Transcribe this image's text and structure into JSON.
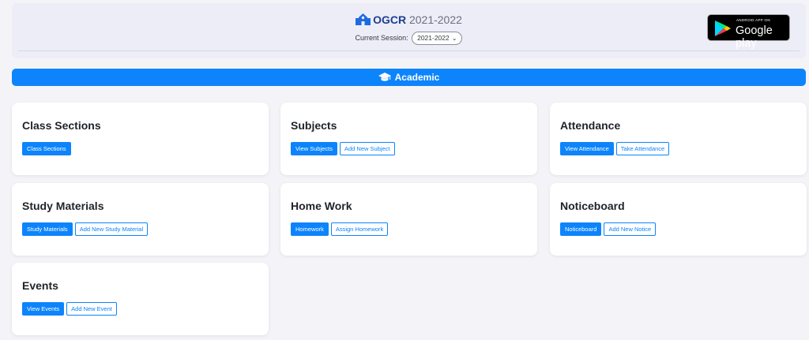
{
  "header": {
    "app_name": "OGCR",
    "app_year": "2021-2022",
    "session_label": "Current Session:",
    "session_value": "2021-2022",
    "store_badge_top": "ANDROID APP ON",
    "store_badge_name": "Google play"
  },
  "section": {
    "title": "Academic"
  },
  "cards": [
    {
      "title": "Class Sections",
      "primary": "Class Sections",
      "secondary": ""
    },
    {
      "title": "Subjects",
      "primary": "View Subjects",
      "secondary": "Add New Subject"
    },
    {
      "title": "Attendance",
      "primary": "View Attendance",
      "secondary": "Take Attendance"
    },
    {
      "title": "Study Materials",
      "primary": "Study Materials",
      "secondary": "Add New Study Material"
    },
    {
      "title": "Home Work",
      "primary": "Homework",
      "secondary": "Assign Homework"
    },
    {
      "title": "Noticeboard",
      "primary": "Noticeboard",
      "secondary": "Add New Notice"
    },
    {
      "title": "Events",
      "primary": "View Events",
      "secondary": "Add New Event"
    }
  ],
  "colors": {
    "accent": "#0d84fb",
    "header_bg": "#ededf7",
    "page_bg": "#f4f4f8"
  },
  "icons": {
    "brand": "school-building-icon",
    "section": "graduation-cap-icon",
    "select": "chevron-down-icon",
    "store": "google-play-icon"
  }
}
